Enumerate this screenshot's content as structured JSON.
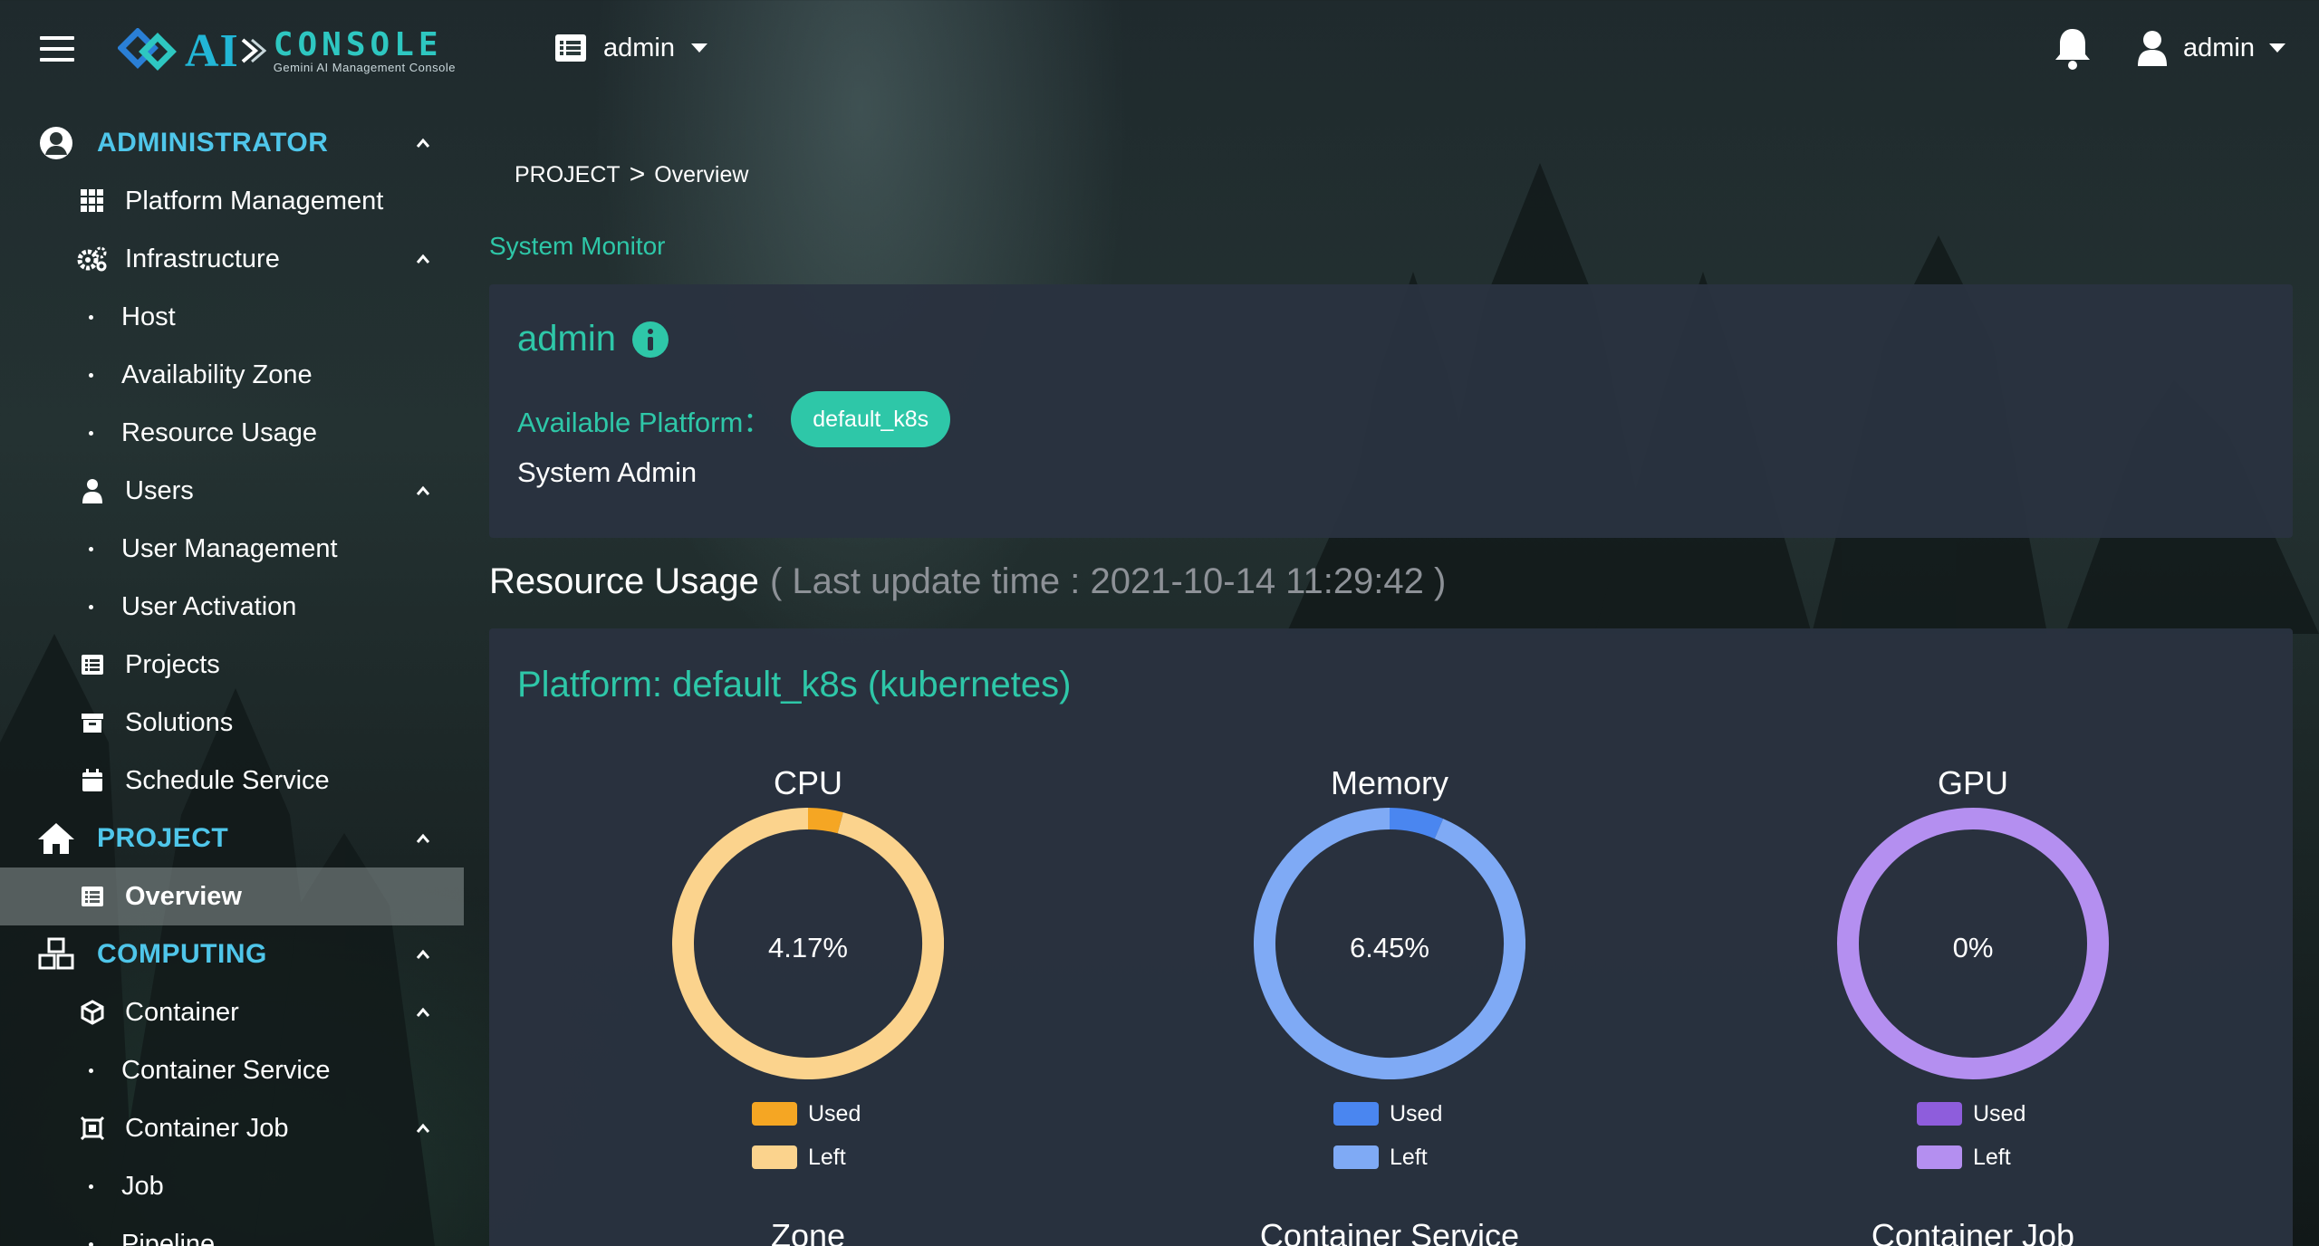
{
  "header": {
    "logo_text_ai": "AI",
    "logo_text_console": "CONSOLE",
    "logo_subtext": "Gemini AI Management Console",
    "project_selector": "admin",
    "user_menu": "admin"
  },
  "sidebar": {
    "administrator": {
      "label": "ADMINISTRATOR",
      "platform_management": "Platform Management",
      "infrastructure": {
        "label": "Infrastructure",
        "host": "Host",
        "availability_zone": "Availability Zone",
        "resource_usage": "Resource Usage"
      },
      "users": {
        "label": "Users",
        "user_management": "User Management",
        "user_activation": "User Activation"
      },
      "projects": "Projects",
      "solutions": "Solutions",
      "schedule_service": "Schedule Service"
    },
    "project": {
      "label": "PROJECT",
      "overview": "Overview"
    },
    "computing": {
      "label": "COMPUTING",
      "container": {
        "label": "Container",
        "container_service": "Container Service"
      },
      "container_job": {
        "label": "Container Job",
        "job": "Job",
        "pipeline": "Pipeline"
      }
    }
  },
  "breadcrumb": {
    "root": "PROJECT",
    "separator": ">",
    "current": "Overview"
  },
  "system_monitor_link": "System Monitor",
  "admin_card": {
    "username": "admin",
    "available_platform_label": "Available Platform：",
    "platform_chip": "default_k8s",
    "role": "System Admin"
  },
  "resource_usage": {
    "title": "Resource Usage",
    "last_update": "( Last update time : 2021-10-14 11:29:42 )",
    "platform_title": "Platform: default_k8s (kubernetes)",
    "legend_used": "Used",
    "legend_left": "Left",
    "lower_titles": {
      "zone": "Zone",
      "container_service": "Container Service",
      "container_job": "Container Job"
    }
  },
  "chart_data": [
    {
      "type": "pie",
      "title": "CPU",
      "center_label": "4.17%",
      "categories": [
        "Used",
        "Left"
      ],
      "values": [
        4.17,
        95.83
      ],
      "colors": [
        "#f5a623",
        "#fbd38d"
      ]
    },
    {
      "type": "pie",
      "title": "Memory",
      "center_label": "6.45%",
      "categories": [
        "Used",
        "Left"
      ],
      "values": [
        6.45,
        93.55
      ],
      "colors": [
        "#4a86f0",
        "#7faaf5"
      ]
    },
    {
      "type": "pie",
      "title": "GPU",
      "center_label": "0%",
      "categories": [
        "Used",
        "Left"
      ],
      "values": [
        0,
        100
      ],
      "colors": [
        "#8e5ddc",
        "#b48ff0"
      ]
    }
  ]
}
